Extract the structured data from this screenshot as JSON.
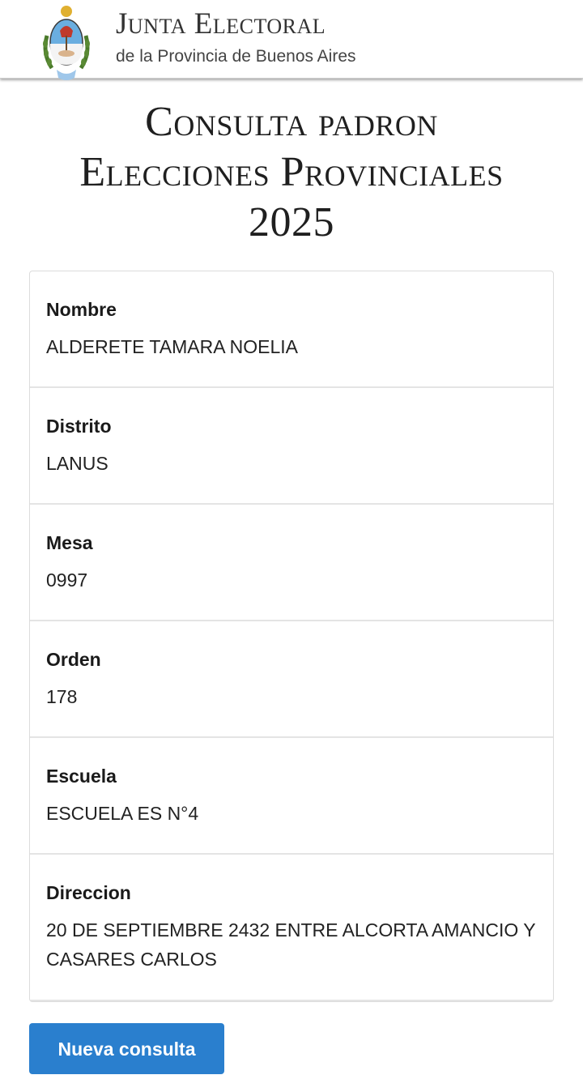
{
  "header": {
    "brand_title": "Junta Electoral",
    "brand_subtitle": "de la Provincia de Buenos Aires",
    "logo_icon": "provincial-coat-of-arms-icon"
  },
  "main": {
    "title_line1": "Consulta padron",
    "title_line2": "Elecciones Provinciales",
    "title_line3": "2025"
  },
  "fields": [
    {
      "label": "Nombre",
      "value": "ALDERETE TAMARA NOELIA"
    },
    {
      "label": "Distrito",
      "value": "LANUS"
    },
    {
      "label": "Mesa",
      "value": "0997"
    },
    {
      "label": "Orden",
      "value": "178"
    },
    {
      "label": "Escuela",
      "value": "ESCUELA ES N°4"
    },
    {
      "label": "Direccion",
      "value": "20 DE SEPTIEMBRE 2432 ENTRE ALCORTA AMANCIO Y CASARES CARLOS"
    }
  ],
  "actions": {
    "new_query_label": "Nueva consulta"
  },
  "colors": {
    "button": "#2a7fce",
    "seal_blue": "#6aaee0",
    "seal_red": "#c0392b",
    "seal_green": "#4a7a2a"
  }
}
